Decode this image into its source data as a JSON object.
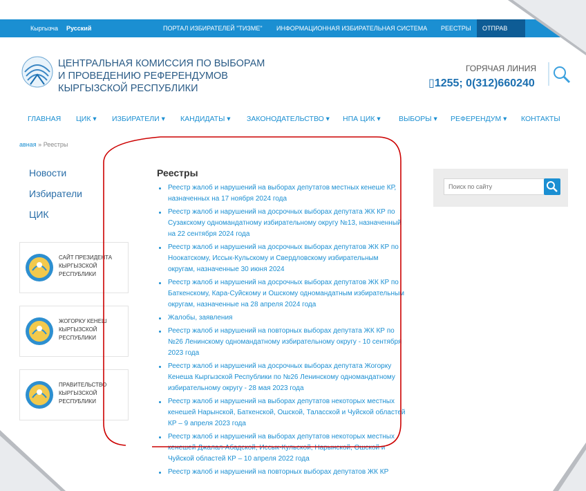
{
  "topbar": {
    "lang_ky": "Кыргызча",
    "lang_ru": "Русский",
    "nav": [
      "ПОРТАЛ ИЗБИРАТЕЛЕЙ \"ТИЗМЕ\"",
      "ИНФОРМАЦИОННАЯ ИЗБИРАТЕЛЬНАЯ СИСТЕМА",
      "РЕЕСТРЫ"
    ],
    "send": "ОТПРАВ"
  },
  "header": {
    "org_name": "ЦЕНТРАЛЬНАЯ КОМИССИЯ ПО ВЫБОРАМ И ПРОВЕДЕНИЮ РЕФЕРЕНДУМОВ КЫРГЫЗСКОЙ РЕСПУБЛИКИ",
    "hotline_label": "ГОРЯЧАЯ ЛИНИЯ",
    "hotline_phone": "1255; 0(312)660240"
  },
  "mainnav": [
    "ГЛАВНАЯ",
    "ЦИК ▾",
    "ИЗБИРАТЕЛИ ▾",
    "КАНДИДАТЫ ▾",
    "ЗАКОНОДАТЕЛЬСТВО ▾",
    "НПА ЦИК ▾",
    "ВЫБОРЫ ▾",
    "РЕФЕРЕНДУМ ▾",
    "КОНТАКТЫ"
  ],
  "breadcrumb": {
    "home": "авная",
    "sep": "»",
    "current": "Реестры"
  },
  "sidebar": {
    "links": [
      "Новости",
      "Избиратели",
      "ЦИК"
    ],
    "banners": [
      "САЙТ ПРЕЗИДЕНТА КЫРГЫЗСКОЙ РЕСПУБЛИКИ",
      "ЖОГОРКУ КЕНЕШ КЫРГЫЗСКОЙ РЕСПУБЛИКИ",
      "ПРАВИТЕЛЬСТВО КЫРГЫЗСКОЙ РЕСПУБЛИКИ"
    ]
  },
  "content": {
    "title": "Реестры",
    "items": [
      "Реестр жалоб и нарушений на выборах депутатов местных кенеше КР, назначенных на 17 ноября 2024 года",
      "Реестр жалоб и нарушений на досрочных выборах депутата ЖК КР по Сузакскому одномандатному избирательному округу №13, назначенный на 22 сентября 2024 года",
      "Реестр жалоб и нарушений на досрочных выборах депутатов ЖК КР по Ноокатскому, Иссык-Кульскому и Свердловскому избирательным округам, назначенные 30 июня 2024",
      "Реестр жалоб и нарушений на досрочных выборах депутатов ЖК КР по Баткенскому, Кара-Суйскому и Ошскому одномандатным избирательным округам, назначенные на 28 апреля 2024 года",
      "Жалобы, заявления",
      "Реестр жалоб и нарушений на повторных выборах депутата ЖК КР по №26 Ленинскому одномандатному избирательному округу - 10 сентября 2023 года",
      "Реестр жалоб и нарушений на досрочных выборах депутата Жогорку Кенеша Кыргызской Республики по №26 Ленинскому одномандатному избирательному округу - 28 мая 2023 года",
      "Реестр жалоб и нарушений на выборах депутатов некоторых местных кенешей Нарынской, Баткенской, Ошской, Таласской и Чуйской областей КР – 9 апреля 2023 года",
      "Реестр жалоб и нарушений на выборах депутатов некоторых местных кенешей Джалал-Абадской, Иссык-Кульской, Нарынской, Ошской и Чуйской областей КР – 10 апреля 2022 года",
      "Реестр жалоб и нарушений на повторных выборах депутатов ЖК КР"
    ]
  },
  "search": {
    "placeholder": "Поиск по сайту"
  },
  "colors": {
    "accent": "#1b8fd2",
    "dark_blue": "#0e5c95",
    "annotation": "#cc0000"
  }
}
